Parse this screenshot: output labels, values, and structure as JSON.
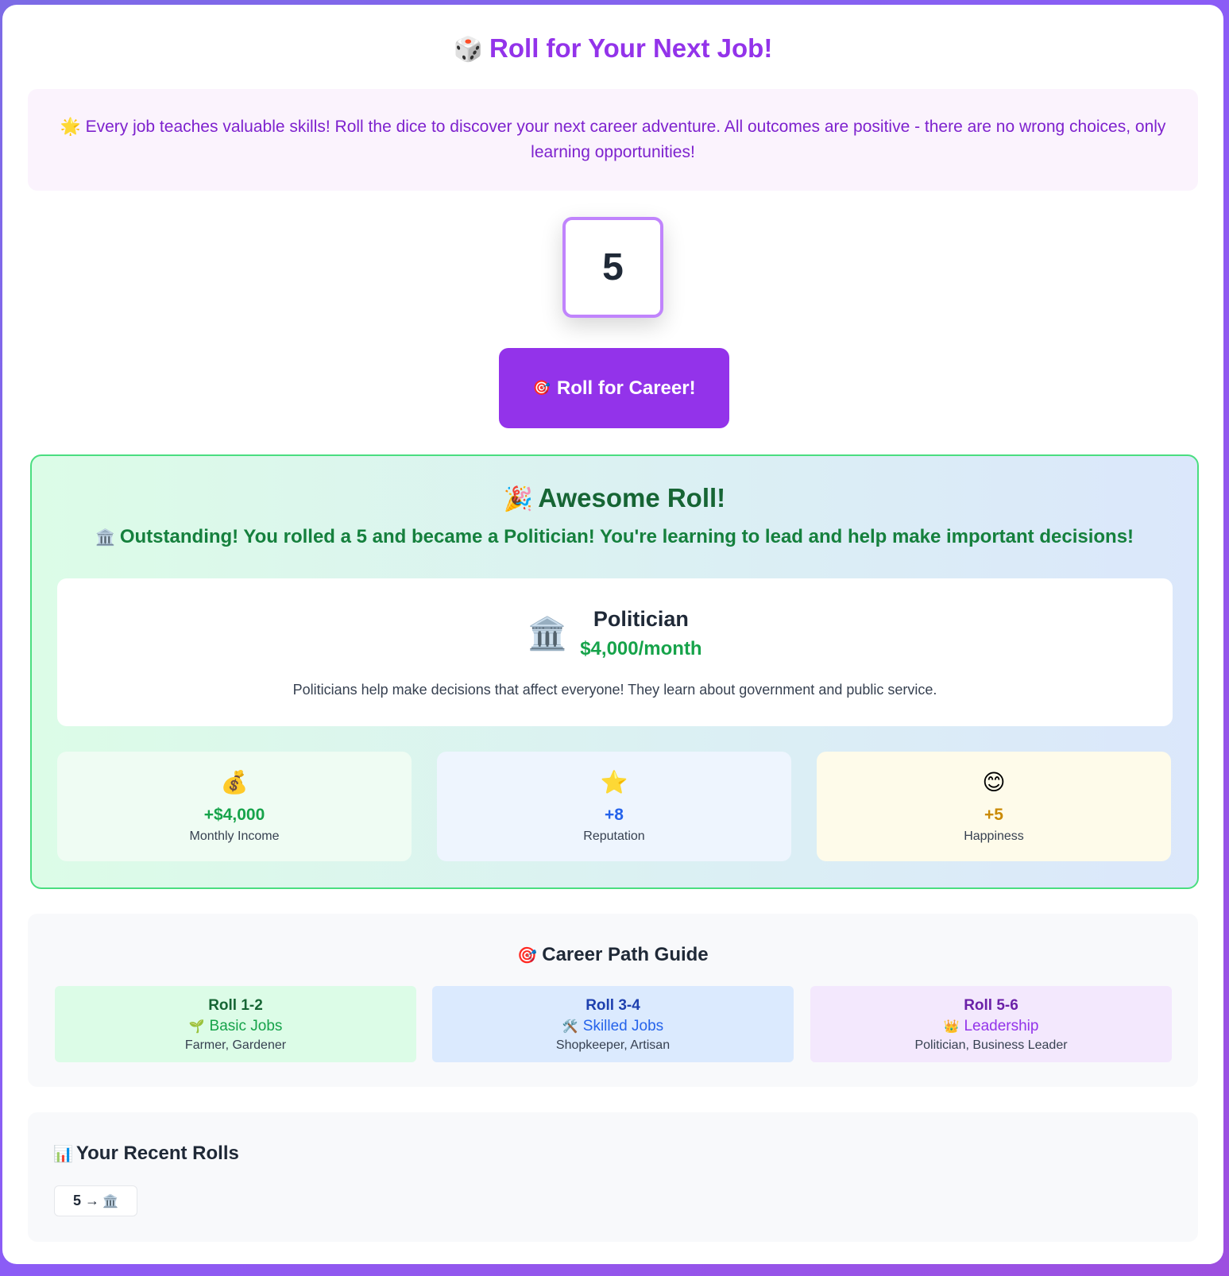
{
  "header": {
    "title_icon": "🎲",
    "title": "Roll for Your Next Job!"
  },
  "intro": {
    "icon": "🌟",
    "text": "Every job teaches valuable skills! Roll the dice to discover your next career adventure. All outcomes are positive - there are no wrong choices, only learning opportunities!"
  },
  "dice": {
    "value": "5"
  },
  "roll_button": {
    "icon": "🎯",
    "label": "Roll for Career!"
  },
  "result": {
    "title_icon": "🎉",
    "title": "Awesome Roll!",
    "message_icon": "🏛️",
    "message": "Outstanding! You rolled a 5 and became a Politician! You're learning to lead and help make important decisions!",
    "job": {
      "icon": "🏛️",
      "name": "Politician",
      "salary": "$4,000/month",
      "description": "Politicians help make decisions that affect everyone! They learn about government and public service."
    },
    "stats": [
      {
        "icon": "💰",
        "value": "+$4,000",
        "label": "Monthly Income"
      },
      {
        "icon": "⭐",
        "value": "+8",
        "label": "Reputation"
      },
      {
        "icon": "😊",
        "value": "+5",
        "label": "Happiness"
      }
    ]
  },
  "guide": {
    "title_icon": "🎯",
    "title": "Career Path Guide",
    "tiers": [
      {
        "roll": "Roll 1-2",
        "icon": "🌱",
        "name": "Basic Jobs",
        "examples": "Farmer, Gardener"
      },
      {
        "roll": "Roll 3-4",
        "icon": "🛠️",
        "name": "Skilled Jobs",
        "examples": "Shopkeeper, Artisan"
      },
      {
        "roll": "Roll 5-6",
        "icon": "👑",
        "name": "Leadership",
        "examples": "Politician, Business Leader"
      }
    ]
  },
  "recent": {
    "title_icon": "📊",
    "title": "Your Recent Rolls",
    "rolls": [
      {
        "text": "5 →",
        "icon": "🏛️"
      }
    ]
  },
  "colors": {
    "accent": "#9333ea",
    "success": "#16a34a",
    "info": "#2563eb",
    "warning": "#ca8a04"
  }
}
